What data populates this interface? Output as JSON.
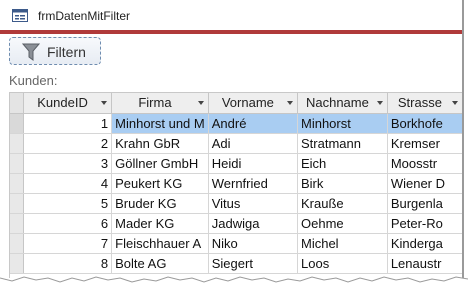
{
  "window": {
    "title": "frmDatenMitFilter"
  },
  "toolbar": {
    "filter_label": "Filtern"
  },
  "subform": {
    "label": "Kunden:"
  },
  "grid": {
    "columns": [
      "KundeID",
      "Firma",
      "Vorname",
      "Nachname",
      "Strasse"
    ],
    "rows": [
      [
        "1",
        "Minhorst und M",
        "André",
        "Minhorst",
        "Borkhofe"
      ],
      [
        "2",
        "Krahn GbR",
        "Adi",
        "Stratmann",
        "Kremser"
      ],
      [
        "3",
        "Göllner GmbH",
        "Heidi",
        "Eich",
        "Moosstr"
      ],
      [
        "4",
        "Peukert KG",
        "Wernfried",
        "Birk",
        "Wiener D"
      ],
      [
        "5",
        "Bruder KG",
        "Vitus",
        "Krauße",
        "Burgenla"
      ],
      [
        "6",
        "Mader KG",
        "Jadwiga",
        "Oehme",
        "Peter-Ro"
      ],
      [
        "7",
        "Fleischhauer A",
        "Niko",
        "Michel",
        "Kinderga"
      ],
      [
        "8",
        "Bolte AG",
        "Siegert",
        "Loos",
        "Lenaustr"
      ]
    ],
    "selected_row": 0
  },
  "colors": {
    "selection": "#a9cdf2",
    "title_border": "#b03a3a"
  }
}
